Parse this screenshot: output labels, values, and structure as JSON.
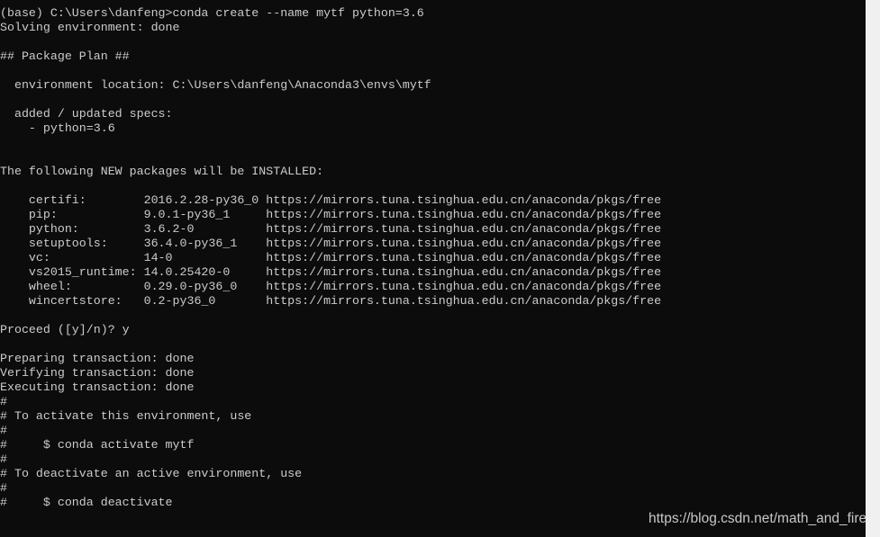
{
  "colors": {
    "background": "#0c0c0c",
    "text": "#cccccc",
    "scrollbar": "#f0f0f0"
  },
  "lines": [
    "(base) C:\\Users\\danfeng>conda create --name mytf python=3.6",
    "Solving environment: done",
    "",
    "## Package Plan ##",
    "",
    "  environment location: C:\\Users\\danfeng\\Anaconda3\\envs\\mytf",
    "",
    "  added / updated specs:",
    "    - python=3.6",
    "",
    "",
    "The following NEW packages will be INSTALLED:",
    "",
    "    certifi:        2016.2.28-py36_0 https://mirrors.tuna.tsinghua.edu.cn/anaconda/pkgs/free",
    "    pip:            9.0.1-py36_1     https://mirrors.tuna.tsinghua.edu.cn/anaconda/pkgs/free",
    "    python:         3.6.2-0          https://mirrors.tuna.tsinghua.edu.cn/anaconda/pkgs/free",
    "    setuptools:     36.4.0-py36_1    https://mirrors.tuna.tsinghua.edu.cn/anaconda/pkgs/free",
    "    vc:             14-0             https://mirrors.tuna.tsinghua.edu.cn/anaconda/pkgs/free",
    "    vs2015_runtime: 14.0.25420-0     https://mirrors.tuna.tsinghua.edu.cn/anaconda/pkgs/free",
    "    wheel:          0.29.0-py36_0    https://mirrors.tuna.tsinghua.edu.cn/anaconda/pkgs/free",
    "    wincertstore:   0.2-py36_0       https://mirrors.tuna.tsinghua.edu.cn/anaconda/pkgs/free",
    "",
    "Proceed ([y]/n)? y",
    "",
    "Preparing transaction: done",
    "Verifying transaction: done",
    "Executing transaction: done",
    "#",
    "# To activate this environment, use",
    "#",
    "#     $ conda activate mytf",
    "#",
    "# To deactivate an active environment, use",
    "#",
    "#     $ conda deactivate"
  ],
  "watermark": "https://blog.csdn.net/math_and_fire"
}
